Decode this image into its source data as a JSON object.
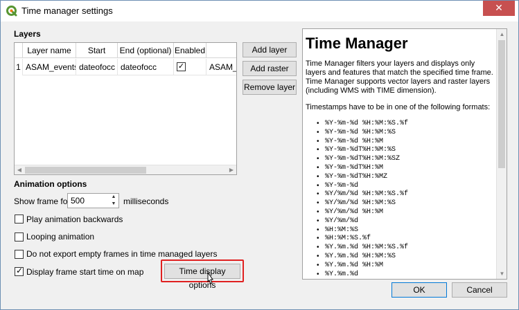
{
  "window": {
    "title": "Time manager settings",
    "close_glyph": "✕"
  },
  "layers": {
    "heading": "Layers",
    "columns": [
      "Layer name",
      "Start",
      "End (optional)",
      "Enabled",
      ""
    ],
    "rows": [
      {
        "num": "1",
        "layer_name": "ASAM_events",
        "start": "dateofocc",
        "end": "dateofocc",
        "enabled": true,
        "extra": "ASAM_e"
      }
    ],
    "scroll_left_glyph": "◀",
    "scroll_right_glyph": "▶"
  },
  "buttons": {
    "add_layer": "Add layer",
    "add_raster": "Add raster",
    "remove_layer": "Remove layer",
    "time_display_options": "Time display options",
    "ok": "OK",
    "cancel": "Cancel"
  },
  "animation": {
    "heading": "Animation options",
    "show_frame_for": "Show frame for",
    "frame_value": "500",
    "milliseconds": "milliseconds",
    "spin_up": "▲",
    "spin_down": "▼",
    "play_backwards": "Play animation backwards",
    "looping": "Looping animation",
    "no_export_empty": "Do not export empty frames in time managed layers",
    "display_frame_start": "Display frame start time on map",
    "play_backwards_checked": false,
    "looping_checked": false,
    "no_export_empty_checked": false,
    "display_frame_start_checked": true
  },
  "help": {
    "title": "Time Manager",
    "paragraph1": "Time Manager filters your layers and displays only layers and features that match the specified time frame. Time Manager supports vector layers and raster layers (including WMS with TIME dimension).",
    "paragraph2": "Timestamps have to be in one of the following formats:",
    "formats": [
      "%Y-%m-%d %H:%M:%S.%f",
      "%Y-%m-%d %H:%M:%S",
      "%Y-%m-%d %H:%M",
      "%Y-%m-%dT%H:%M:%S",
      "%Y-%m-%dT%H:%M:%SZ",
      "%Y-%m-%dT%H:%M",
      "%Y-%m-%dT%H:%MZ",
      "%Y-%m-%d",
      "%Y/%m/%d %H:%M:%S.%f",
      "%Y/%m/%d %H:%M:%S",
      "%Y/%m/%d %H:%M",
      "%Y/%m/%d",
      "%H:%M:%S",
      "%H:%M:%S.%f",
      "%Y.%m.%d %H:%M:%S.%f",
      "%Y.%m.%d %H:%M:%S",
      "%Y.%m.%d %H:%M",
      "%Y.%m.%d"
    ],
    "scroll_up_glyph": "▲",
    "scroll_down_glyph": "▼"
  },
  "colors": {
    "highlight": "#e02020",
    "qgis_green": "#589632",
    "close_red": "#c75050",
    "focus_blue": "#0078d7"
  },
  "icons": {
    "app": "qgis-logo-icon",
    "close": "close-icon",
    "cursor": "mouse-pointer-icon",
    "checkbox": "checkmark-icon"
  }
}
